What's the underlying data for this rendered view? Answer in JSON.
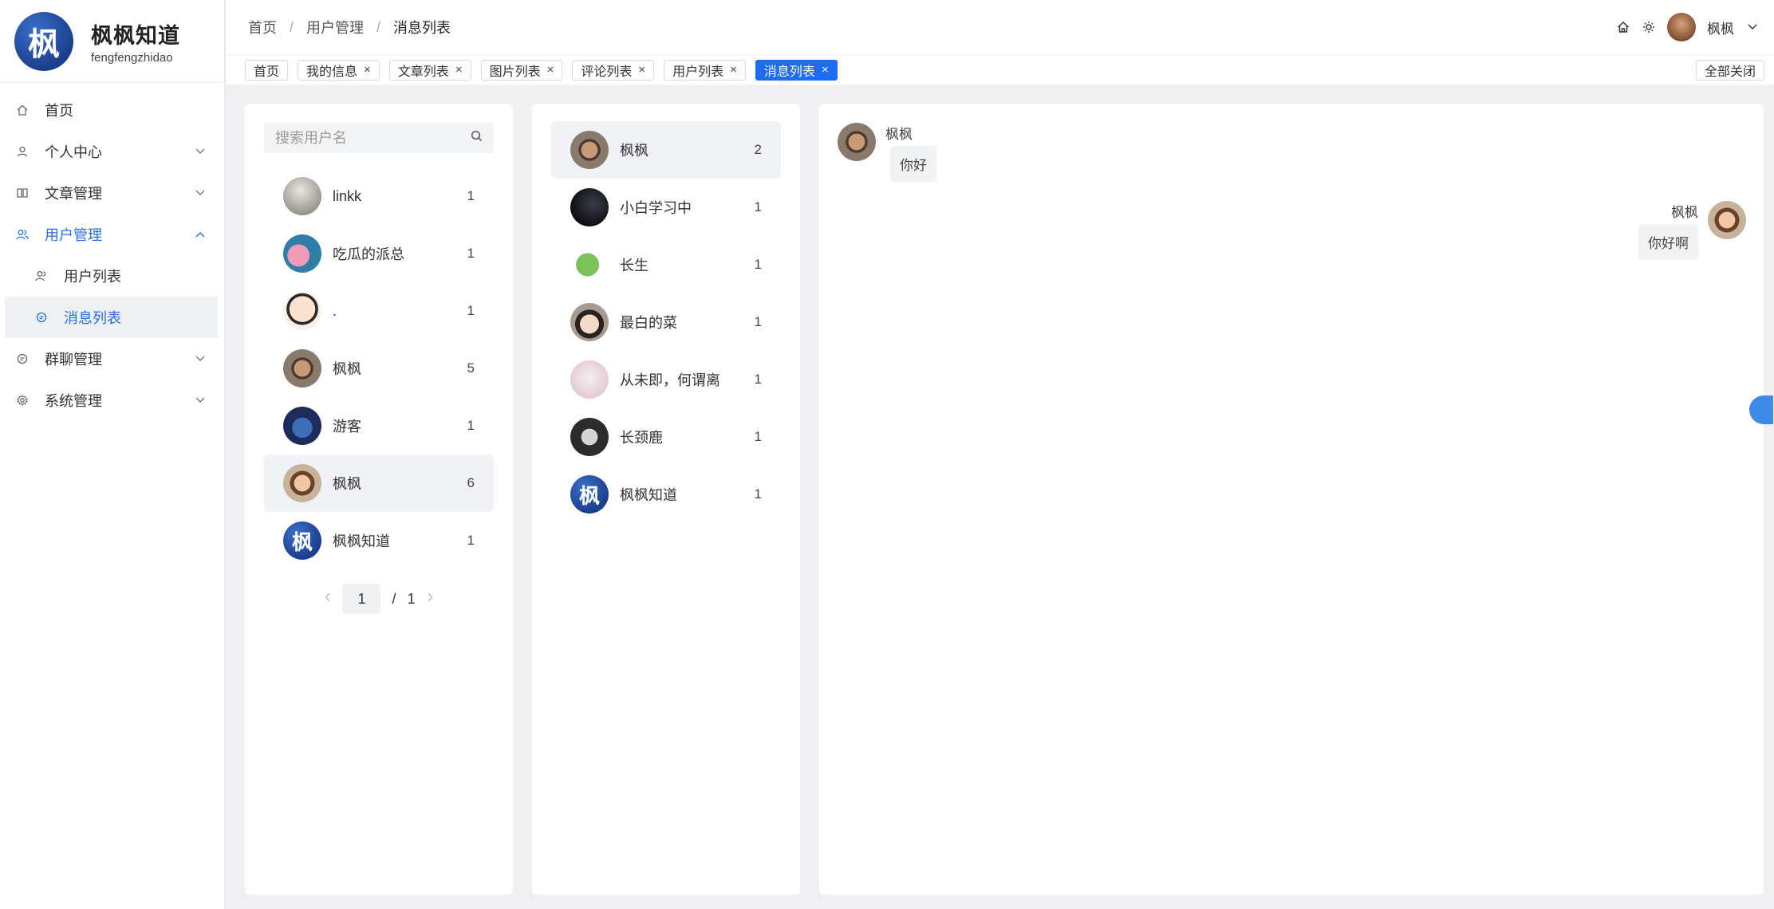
{
  "sidebar": {
    "logo_char": "枫",
    "title": "枫枫知道",
    "subtitle": "fengfengzhidao",
    "items": [
      {
        "label": "首页",
        "icon": "home-icon"
      },
      {
        "label": "个人中心",
        "icon": "user-icon"
      },
      {
        "label": "文章管理",
        "icon": "book-icon"
      },
      {
        "label": "用户管理",
        "icon": "users-icon"
      },
      {
        "label": "用户列表",
        "icon": "user-list-icon"
      },
      {
        "label": "消息列表",
        "icon": "message-icon"
      },
      {
        "label": "群聊管理",
        "icon": "group-chat-icon"
      },
      {
        "label": "系统管理",
        "icon": "settings-icon"
      }
    ]
  },
  "header": {
    "breadcrumb": [
      "首页",
      "用户管理",
      "消息列表"
    ],
    "username": "枫枫"
  },
  "tabs": [
    "首页",
    "我的信息",
    "文章列表",
    "图片列表",
    "评论列表",
    "用户列表",
    "消息列表"
  ],
  "close_all": "全部关闭",
  "search": {
    "placeholder": "搜索用户名"
  },
  "users": [
    {
      "name": "linkk",
      "count": "1",
      "avatar_color": "#b9b7b0"
    },
    {
      "name": "吃瓜的派总",
      "count": "1",
      "avatar_color": "#2e7ea8"
    },
    {
      "name": ".",
      "count": "1",
      "avatar_color": "#f4d9c0"
    },
    {
      "name": "枫枫",
      "count": "5",
      "avatar_color": "#6b5a4c"
    },
    {
      "name": "游客",
      "count": "1",
      "avatar_color": "#2b3f7a"
    },
    {
      "name": "枫枫",
      "count": "6",
      "avatar_color": "#b78a66"
    },
    {
      "name": "枫枫知道",
      "count": "1",
      "avatar_color": "#1f4599"
    }
  ],
  "pager": {
    "current": "1",
    "sep": "/",
    "total": "1"
  },
  "contacts": [
    {
      "name": "枫枫",
      "count": "2",
      "avatar_color": "#6b5a4c"
    },
    {
      "name": "小白学习中",
      "count": "1",
      "avatar_color": "#1d1d22"
    },
    {
      "name": "长生",
      "count": "1",
      "avatar_color": "#7cc25a"
    },
    {
      "name": "最白的菜",
      "count": "1",
      "avatar_color": "#a88a78"
    },
    {
      "name": "从未即，何谓离",
      "count": "1",
      "avatar_color": "#ecdde3"
    },
    {
      "name": "长颈鹿",
      "count": "1",
      "avatar_color": "#3b3b3d"
    },
    {
      "name": "枫枫知道",
      "count": "1",
      "avatar_color": "#1f4599"
    }
  ],
  "messages": [
    {
      "side": "left",
      "name": "枫枫",
      "text": "你好"
    },
    {
      "side": "right",
      "name": "枫枫",
      "text": "你好啊"
    }
  ]
}
